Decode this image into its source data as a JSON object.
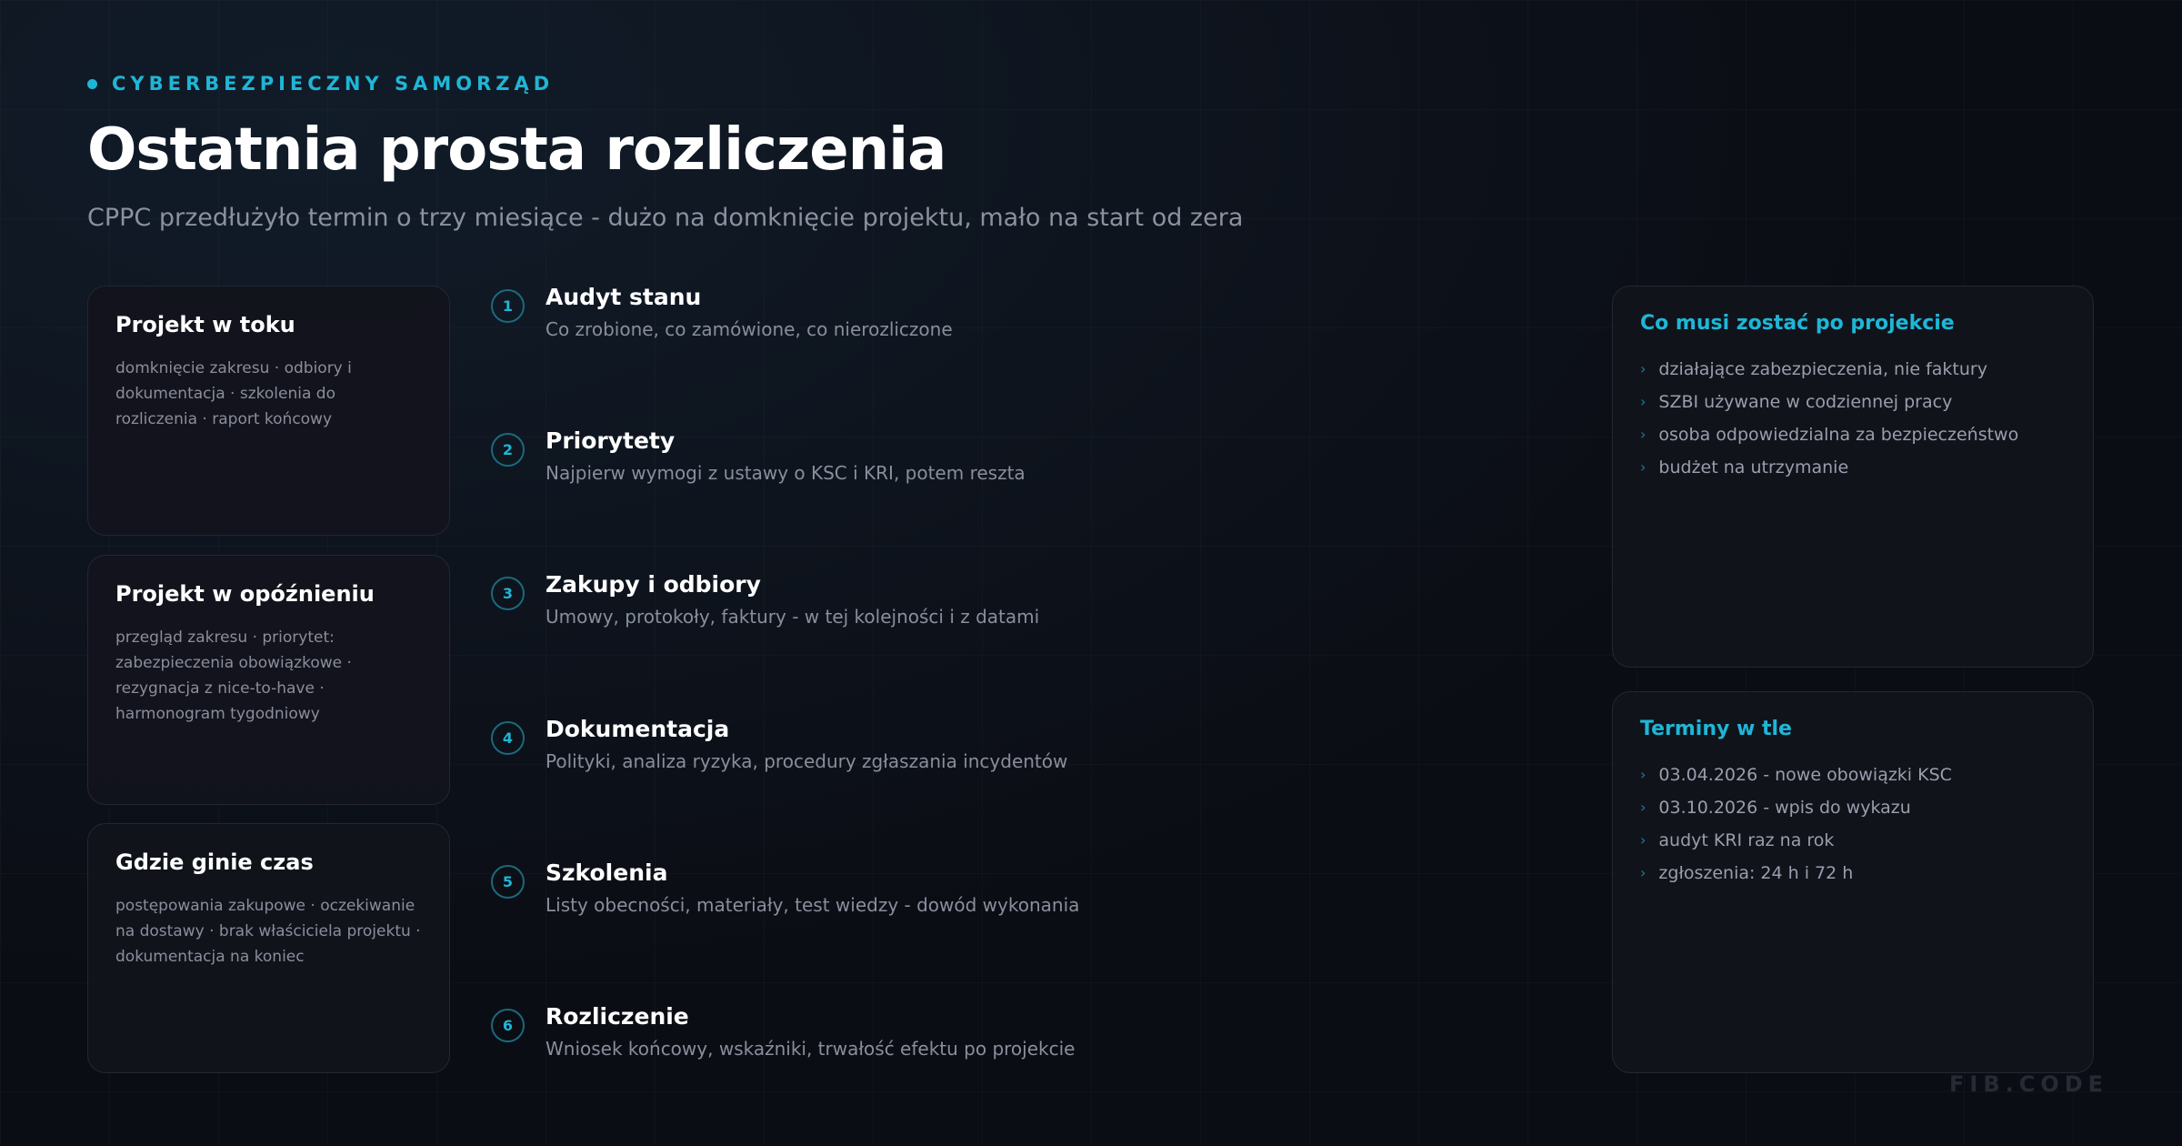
{
  "header": {
    "eyebrow": "CYBERBEZPIECZNY SAMORZĄD",
    "title": "Ostatnia prosta rozliczenia",
    "subtitle": "CPPC przedłużyło termin o trzy miesiące - dużo na domknięcie projektu, mało na start od zera"
  },
  "left_cards": [
    {
      "title": "Projekt w toku",
      "text": "domknięcie zakresu · odbiory i dokumentacja · szkolenia do rozliczenia · raport końcowy"
    },
    {
      "title": "Projekt w opóźnieniu",
      "text": "przegląd zakresu · priorytet: zabezpieczenia obowiązkowe · rezygnacja z nice-to-have · harmonogram tygodniowy"
    },
    {
      "title": "Gdzie ginie czas",
      "text": "postępowania zakupowe · oczekiwanie na dostawy · brak właściciela projektu · dokumentacja na koniec"
    }
  ],
  "steps": [
    {
      "num": "1",
      "title": "Audyt stanu",
      "desc": "Co zrobione, co zamówione, co nierozliczone"
    },
    {
      "num": "2",
      "title": "Priorytety",
      "desc": "Najpierw wymogi z ustawy o KSC i KRI, potem reszta"
    },
    {
      "num": "3",
      "title": "Zakupy i odbiory",
      "desc": "Umowy, protokoły, faktury - w tej kolejności i z datami"
    },
    {
      "num": "4",
      "title": "Dokumentacja",
      "desc": "Polityki, analiza ryzyka, procedury zgłaszania incydentów"
    },
    {
      "num": "5",
      "title": "Szkolenia",
      "desc": "Listy obecności, materiały, test wiedzy - dowód wykonania"
    },
    {
      "num": "6",
      "title": "Rozliczenie",
      "desc": "Wniosek końcowy, wskaźniki, trwałość efektu po projekcie"
    }
  ],
  "right_cards": [
    {
      "title": "Co musi zostać po projekcie",
      "items": [
        "działające zabezpieczenia, nie faktury",
        "SZBI używane w codziennej pracy",
        "osoba odpowiedzialna za bezpieczeństwo",
        "budżet na utrzymanie"
      ]
    },
    {
      "title": "Terminy w tle",
      "items": [
        "03.04.2026 - nowe obowiązki KSC",
        "03.10.2026 - wpis do wykazu",
        "audyt KRI raz na rok",
        "zgłoszenia: 24 h i 72 h"
      ]
    }
  ],
  "bullet_glyph": "›",
  "brand": "FIB.CODE",
  "colors": {
    "accent": "#1fb6d6",
    "background": "#0b0d14",
    "card": "#12141c",
    "muted_text": "#8a8e9c"
  }
}
